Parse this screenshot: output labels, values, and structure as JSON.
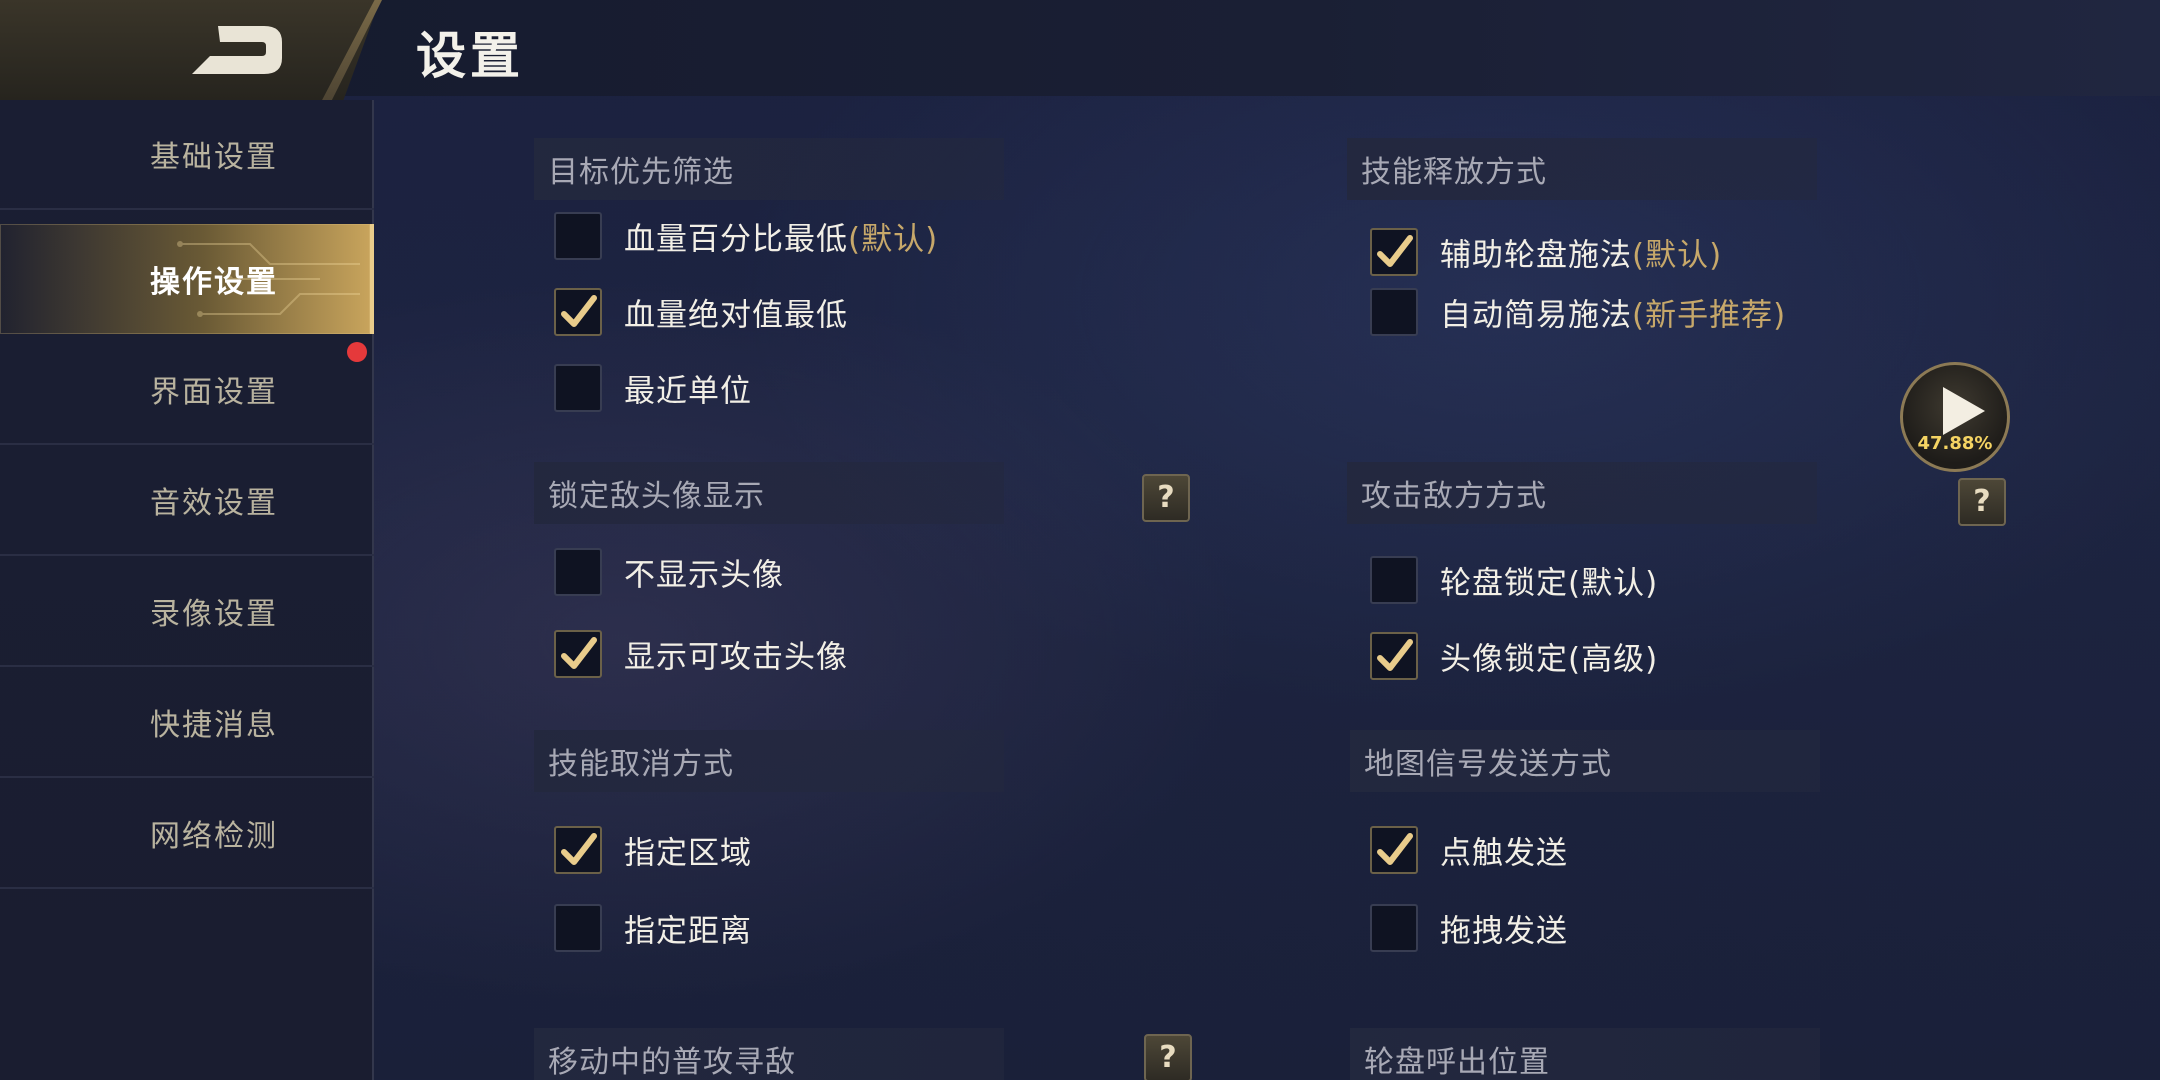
{
  "header": {
    "title": "设置"
  },
  "sidebar": {
    "items": [
      {
        "label": "基础设置"
      },
      {
        "label": "操作设置"
      },
      {
        "label": "界面设置"
      },
      {
        "label": "音效设置"
      },
      {
        "label": "录像设置"
      },
      {
        "label": "快捷消息"
      },
      {
        "label": "网络检测"
      }
    ],
    "active_index": 1
  },
  "sections": {
    "target_priority": {
      "title": "目标优先筛选",
      "options": [
        {
          "label": "血量百分比最低",
          "hint": "(默认)",
          "checked": false
        },
        {
          "label": "血量绝对值最低",
          "hint": "",
          "checked": true
        },
        {
          "label": "最近单位",
          "hint": "",
          "checked": false
        }
      ]
    },
    "skill_cast": {
      "title": "技能释放方式",
      "options": [
        {
          "label": "辅助轮盘施法",
          "hint": "(默认)",
          "checked": true
        },
        {
          "label": "自动简易施法",
          "hint": "(新手推荐)",
          "checked": false
        }
      ]
    },
    "lock_avatar": {
      "title": "锁定敌头像显示",
      "help": "?",
      "options": [
        {
          "label": "不显示头像",
          "checked": false
        },
        {
          "label": "显示可攻击头像",
          "checked": true
        }
      ]
    },
    "attack_mode": {
      "title": "攻击敌方方式",
      "help": "?",
      "options": [
        {
          "label": "轮盘锁定(默认)",
          "checked": false
        },
        {
          "label": "头像锁定(高级)",
          "checked": true
        }
      ]
    },
    "skill_cancel": {
      "title": "技能取消方式",
      "options": [
        {
          "label": "指定区域",
          "checked": true
        },
        {
          "label": "指定距离",
          "checked": false
        }
      ]
    },
    "map_signal": {
      "title": "地图信号发送方式",
      "options": [
        {
          "label": "点触发送",
          "checked": true
        },
        {
          "label": "拖拽发送",
          "checked": false
        }
      ]
    },
    "move_attack": {
      "title": "移动中的普攻寻敌",
      "help": "?"
    },
    "wheel_position": {
      "title": "轮盘呼出位置"
    }
  },
  "play_badge": {
    "percent": "47.88%"
  },
  "colors": {
    "accent_gold": "#c8a45c",
    "check_gold": "#e9cc8b",
    "alert_dot": "#e5393b"
  }
}
